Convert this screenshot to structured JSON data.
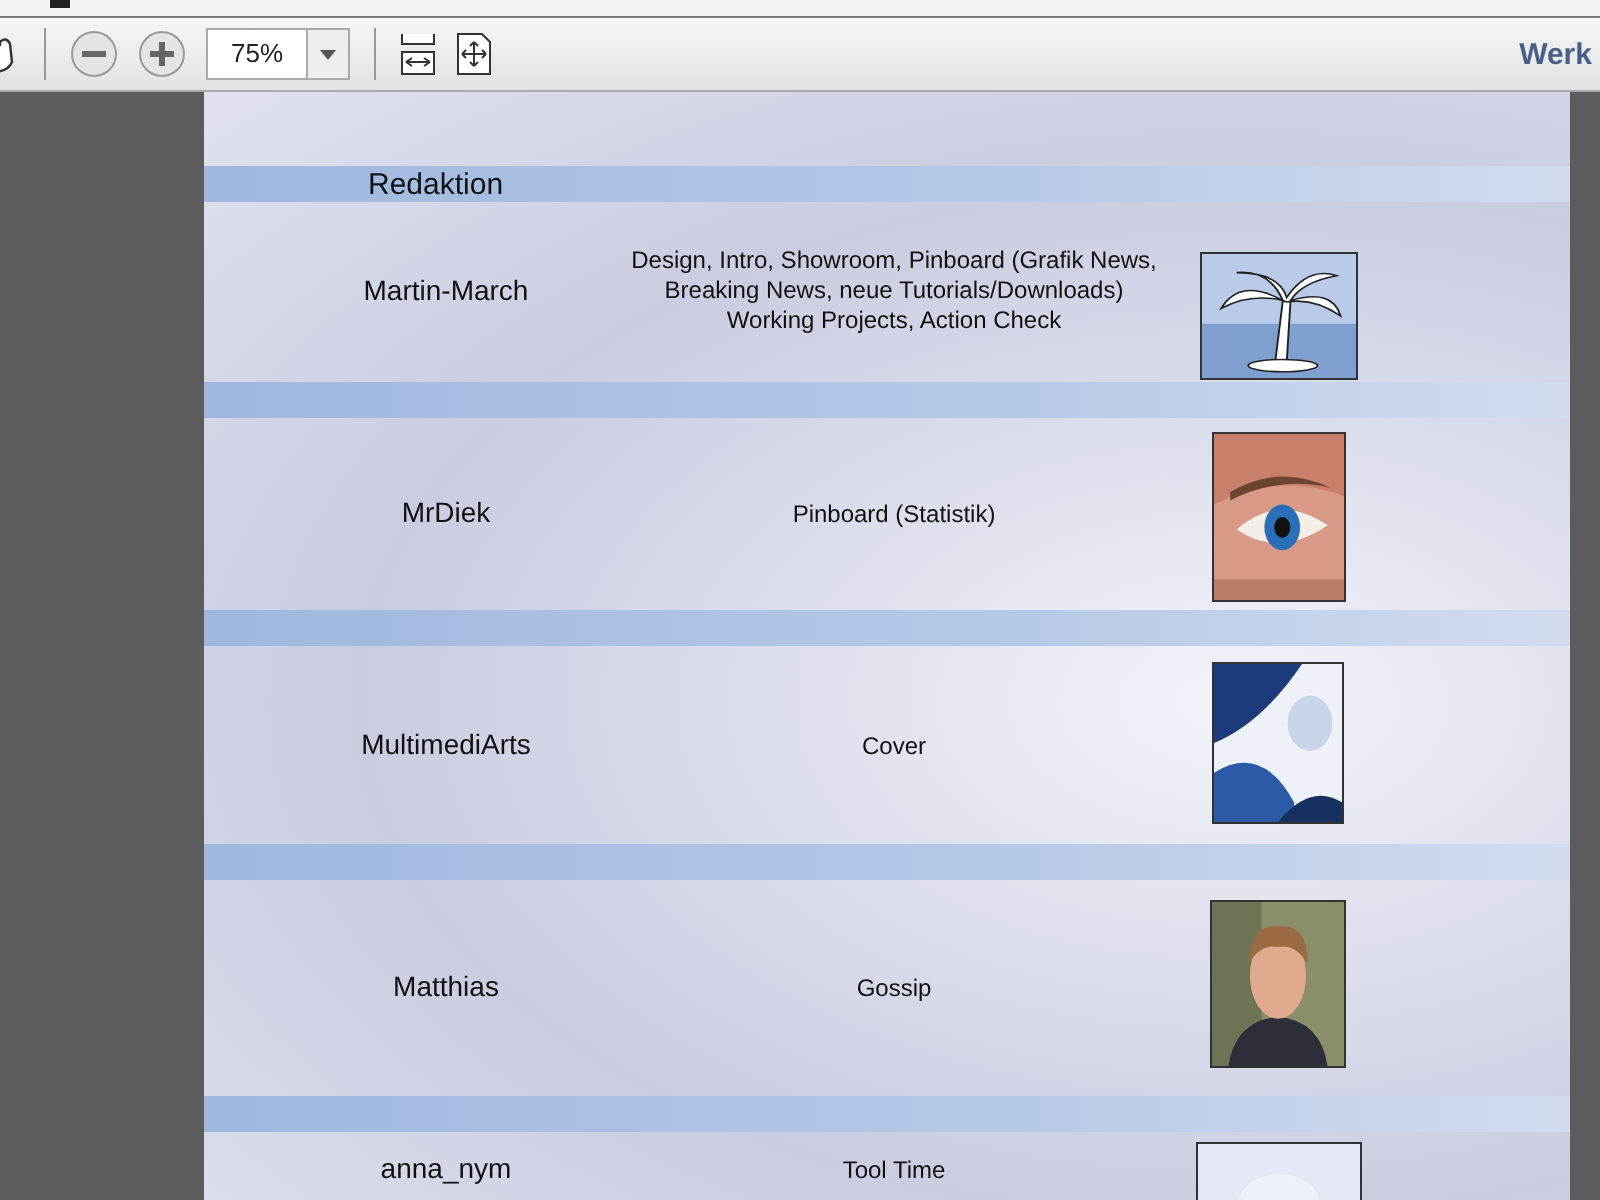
{
  "toolbar": {
    "zoom": "75%",
    "right_label": "Werk"
  },
  "document": {
    "heading": "Redaktion",
    "rows": [
      {
        "name": "Martin-March",
        "tasks": "Design, Intro, Showroom, Pinboard (Grafik News,\nBreaking News, neue Tutorials/Downloads)\nWorking Projects, Action Check"
      },
      {
        "name": "MrDiek",
        "tasks": "Pinboard (Statistik)"
      },
      {
        "name": "MultimediArts",
        "tasks": "Cover"
      },
      {
        "name": "Matthias",
        "tasks": "Gossip"
      },
      {
        "name": "anna_nym",
        "tasks": "Tool Time"
      }
    ]
  }
}
